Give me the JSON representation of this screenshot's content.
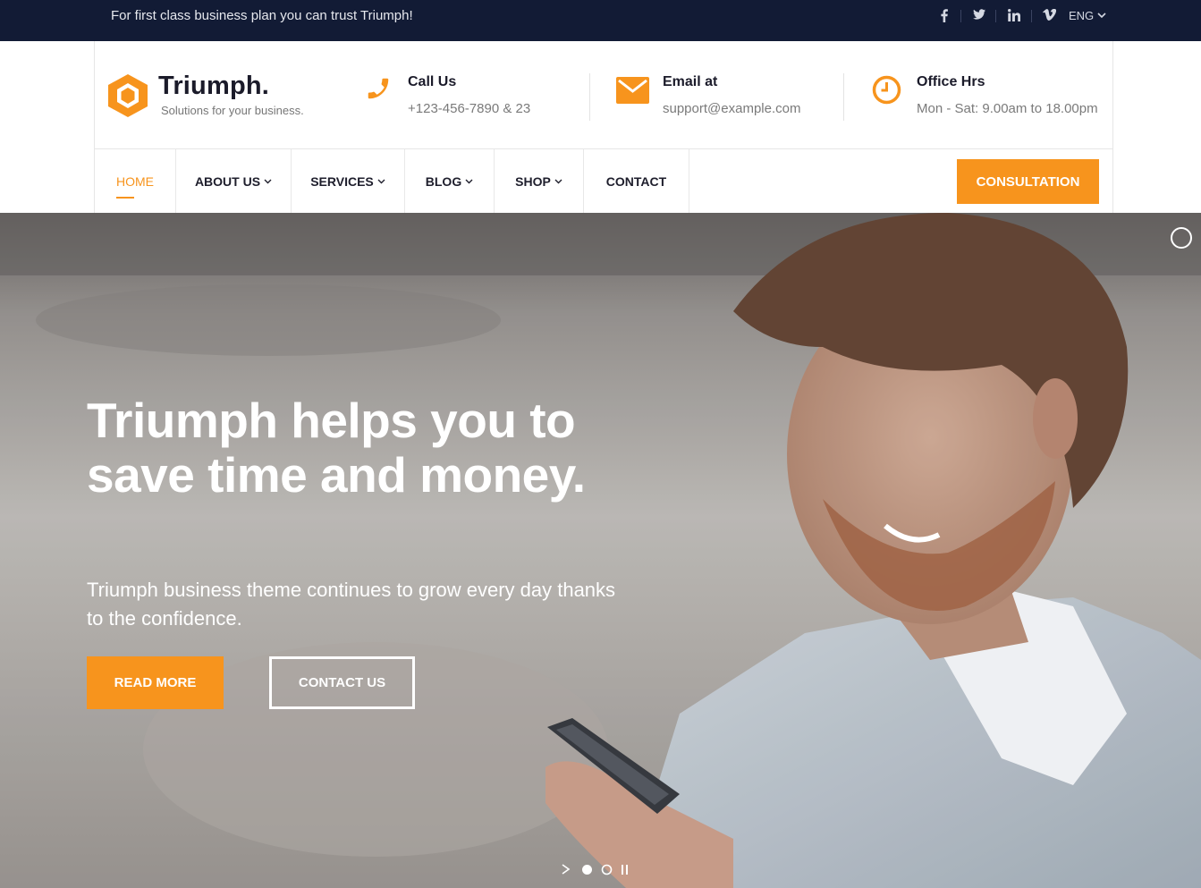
{
  "topbar": {
    "tagline": "For first class business plan you can trust Triumph!",
    "social": [
      {
        "icon": "facebook-icon",
        "glyph": "f"
      },
      {
        "icon": "twitter-icon",
        "glyph": "t"
      },
      {
        "icon": "linkedin-icon",
        "glyph": "in"
      },
      {
        "icon": "vimeo-icon",
        "glyph": "v"
      }
    ],
    "language": "ENG"
  },
  "brand": {
    "name": "Triumph.",
    "tagline": "Solutions for your business.",
    "accent": "#f7941d",
    "dark": "#121b35"
  },
  "contact_info": {
    "call": {
      "title": "Call Us",
      "value": "+123-456-7890 & 23"
    },
    "email": {
      "title": "Email at",
      "value": "support@example.com"
    },
    "hours": {
      "title": "Office Hrs",
      "value": "Mon - Sat: 9.00am to 18.00pm"
    }
  },
  "nav": {
    "items": [
      {
        "label": "HOME"
      },
      {
        "label": "ABOUT US"
      },
      {
        "label": "SERVICES"
      },
      {
        "label": "BLOG"
      },
      {
        "label": "SHOP"
      },
      {
        "label": "CONTACT"
      }
    ],
    "cta": "CONSULTATION"
  },
  "hero": {
    "title": "Triumph helps you to save time and money.",
    "subtitle": "Triumph business theme continues to grow every day thanks to the confidence.",
    "primary_button": "READ MORE",
    "secondary_button": "CONTACT US",
    "controls": {
      "next": ">",
      "pause": "II"
    }
  }
}
